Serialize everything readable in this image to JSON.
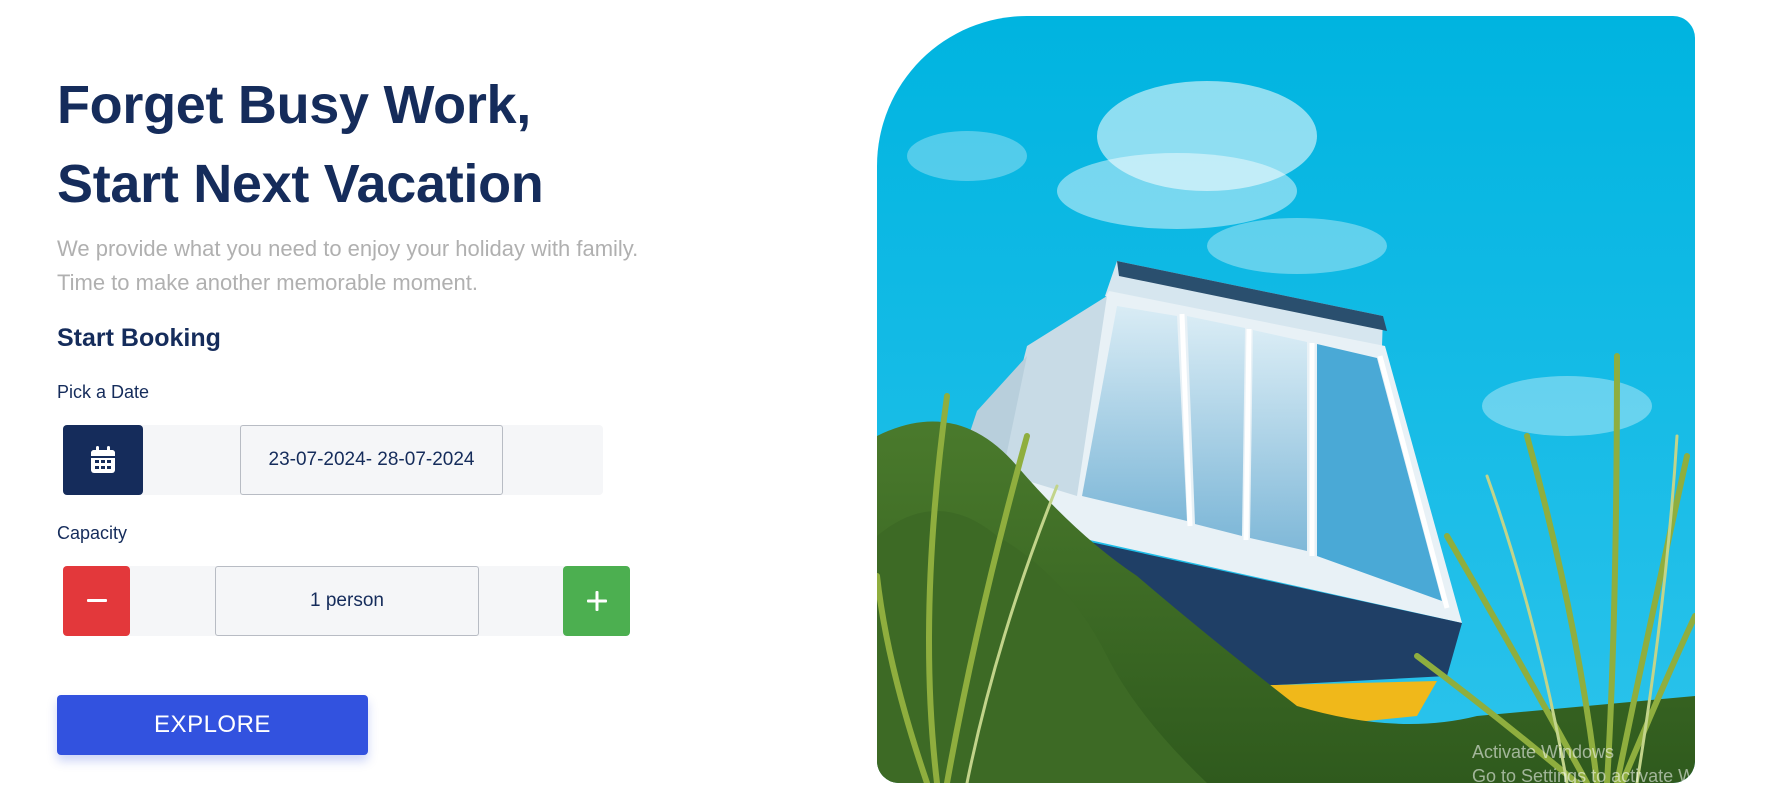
{
  "hero": {
    "title_line1": "Forget Busy Work,",
    "title_line2": "Start Next Vacation",
    "subtitle_line1": "We provide what you need to enjoy your holiday with family.",
    "subtitle_line2": "Time to make another memorable moment."
  },
  "booking": {
    "title": "Start Booking",
    "date_label": "Pick a Date",
    "date_value": "23-07-2024- 28-07-2024",
    "date_icon": "calendar-icon",
    "capacity_label": "Capacity",
    "capacity_value": "1 person",
    "minus_icon": "minus-icon",
    "plus_icon": "plus-icon",
    "explore_label": "EXPLORE"
  },
  "watermark": {
    "line1": "Activate Windows",
    "line2": "Go to Settings to activate Windows."
  },
  "colors": {
    "primary": "#152c5b",
    "accent_blue": "#3252df",
    "minus_red": "#e3383b",
    "plus_green": "#4caf50",
    "muted_text": "#b0b0b0",
    "field_bg": "#f5f6f8"
  }
}
